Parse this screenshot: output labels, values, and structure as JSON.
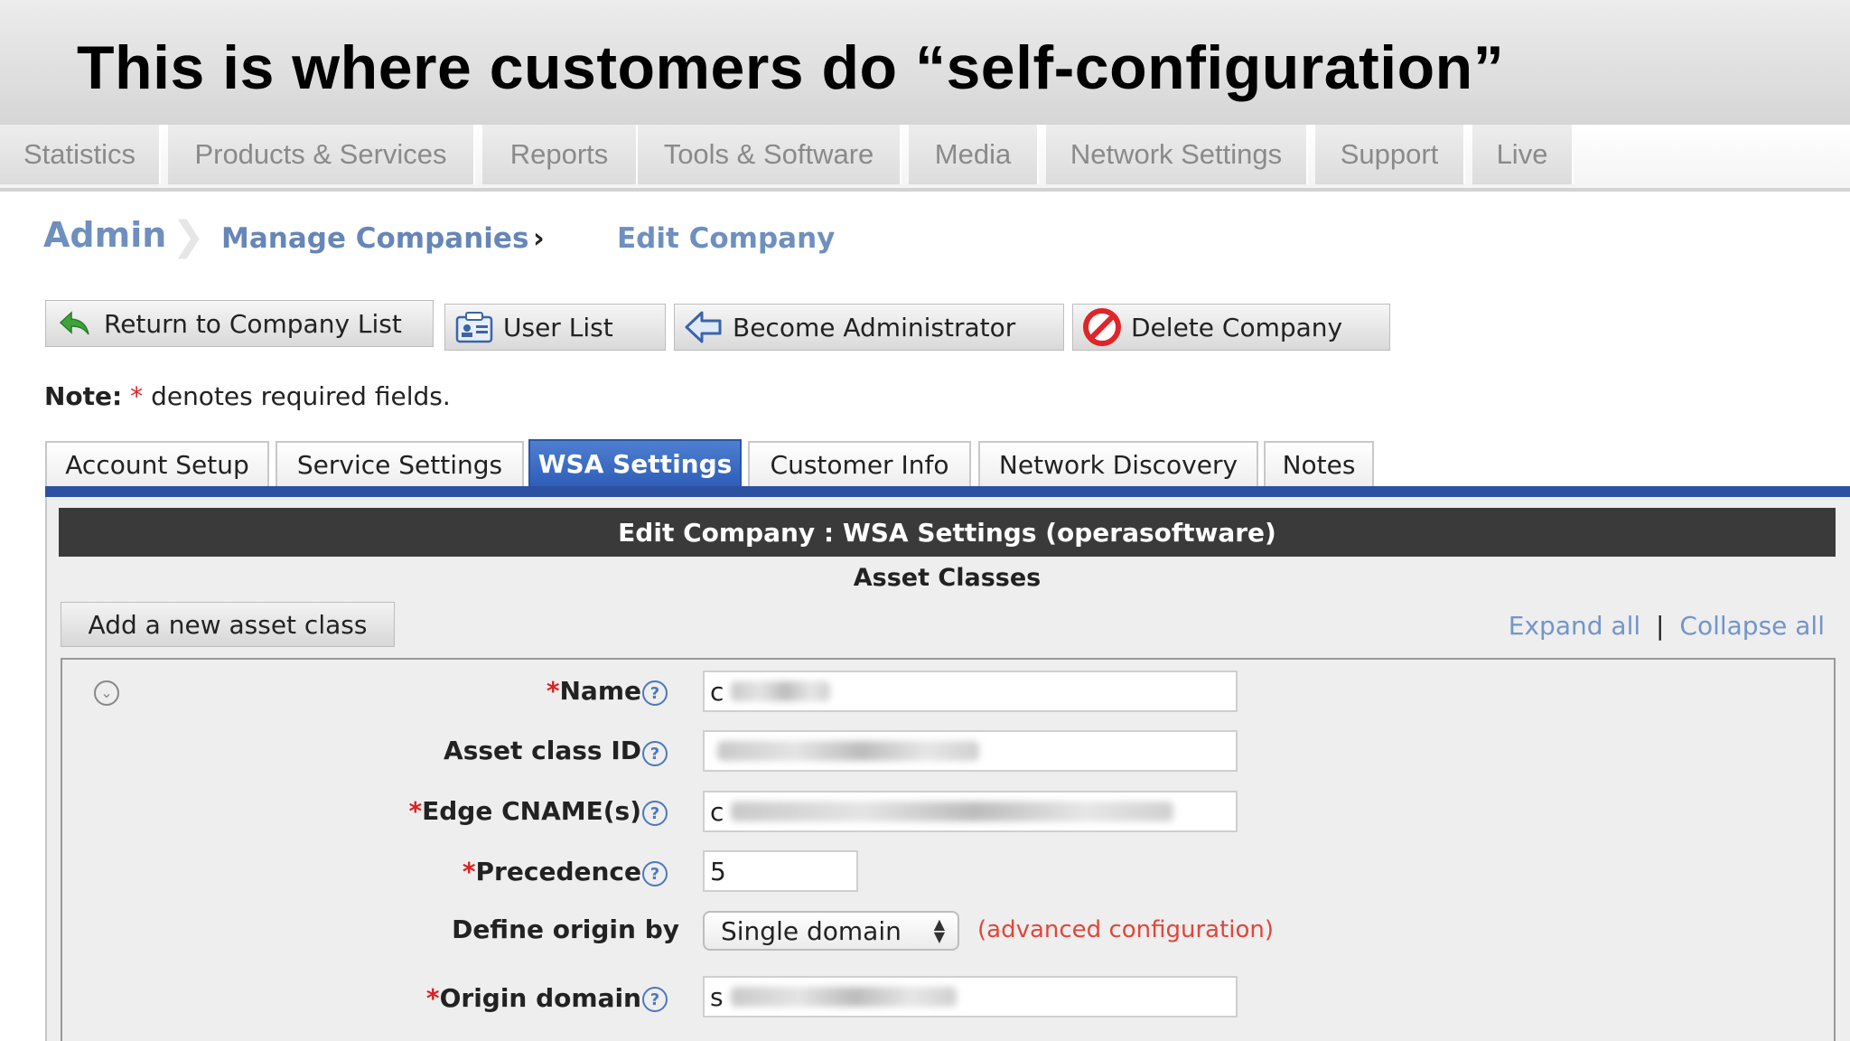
{
  "slide": {
    "title": "This is where customers do “self-configuration”"
  },
  "topnav": {
    "items": [
      {
        "label": "Statistics"
      },
      {
        "label": "Products & Services"
      },
      {
        "label": "Reports"
      },
      {
        "label": "Tools & Software"
      },
      {
        "label": "Media"
      },
      {
        "label": "Network Settings"
      },
      {
        "label": "Support"
      },
      {
        "label": "Live"
      }
    ]
  },
  "breadcrumb": {
    "admin": "Admin",
    "manage": "Manage Companies",
    "separator": "›",
    "current": "Edit Company"
  },
  "actions": {
    "return_label": "Return to Company List",
    "userlist_label": "User List",
    "become_admin_label": "Become Administrator",
    "delete_label": "Delete Company"
  },
  "note": {
    "prefix": "Note:",
    "star": "*",
    "text": "denotes required fields."
  },
  "tabs": [
    {
      "label": "Account Setup"
    },
    {
      "label": "Service Settings"
    },
    {
      "label": "WSA Settings",
      "active": true
    },
    {
      "label": "Customer Info"
    },
    {
      "label": "Network Discovery"
    },
    {
      "label": "Notes"
    }
  ],
  "panel": {
    "title": "Edit Company : WSA Settings (operasoftware)",
    "section_title": "Asset Classes",
    "add_button": "Add a new asset class",
    "expand_all": "Expand all",
    "link_separator": "|",
    "collapse_all": "Collapse all"
  },
  "form": {
    "required_star": "*",
    "help_glyph": "?",
    "name_label": "Name",
    "name_value_visible": "c",
    "asset_class_id_label": "Asset class ID",
    "asset_class_id_value_visible": "",
    "edge_cname_label": "Edge CNAME(s)",
    "edge_cname_value_visible": "c",
    "precedence_label": "Precedence",
    "precedence_value": "5",
    "define_origin_label": "Define origin by",
    "define_origin_selected": "Single domain",
    "advanced_link": "(advanced configuration)",
    "origin_domain_label": "Origin domain",
    "origin_domain_value_visible": "s"
  },
  "colors": {
    "tab_active": "#3a6bc4",
    "tab_line": "#2d51a1",
    "panel_header": "#3a3a3a",
    "link": "#7395c9",
    "advanced_link": "#e0463a",
    "required": "#dd2222"
  }
}
